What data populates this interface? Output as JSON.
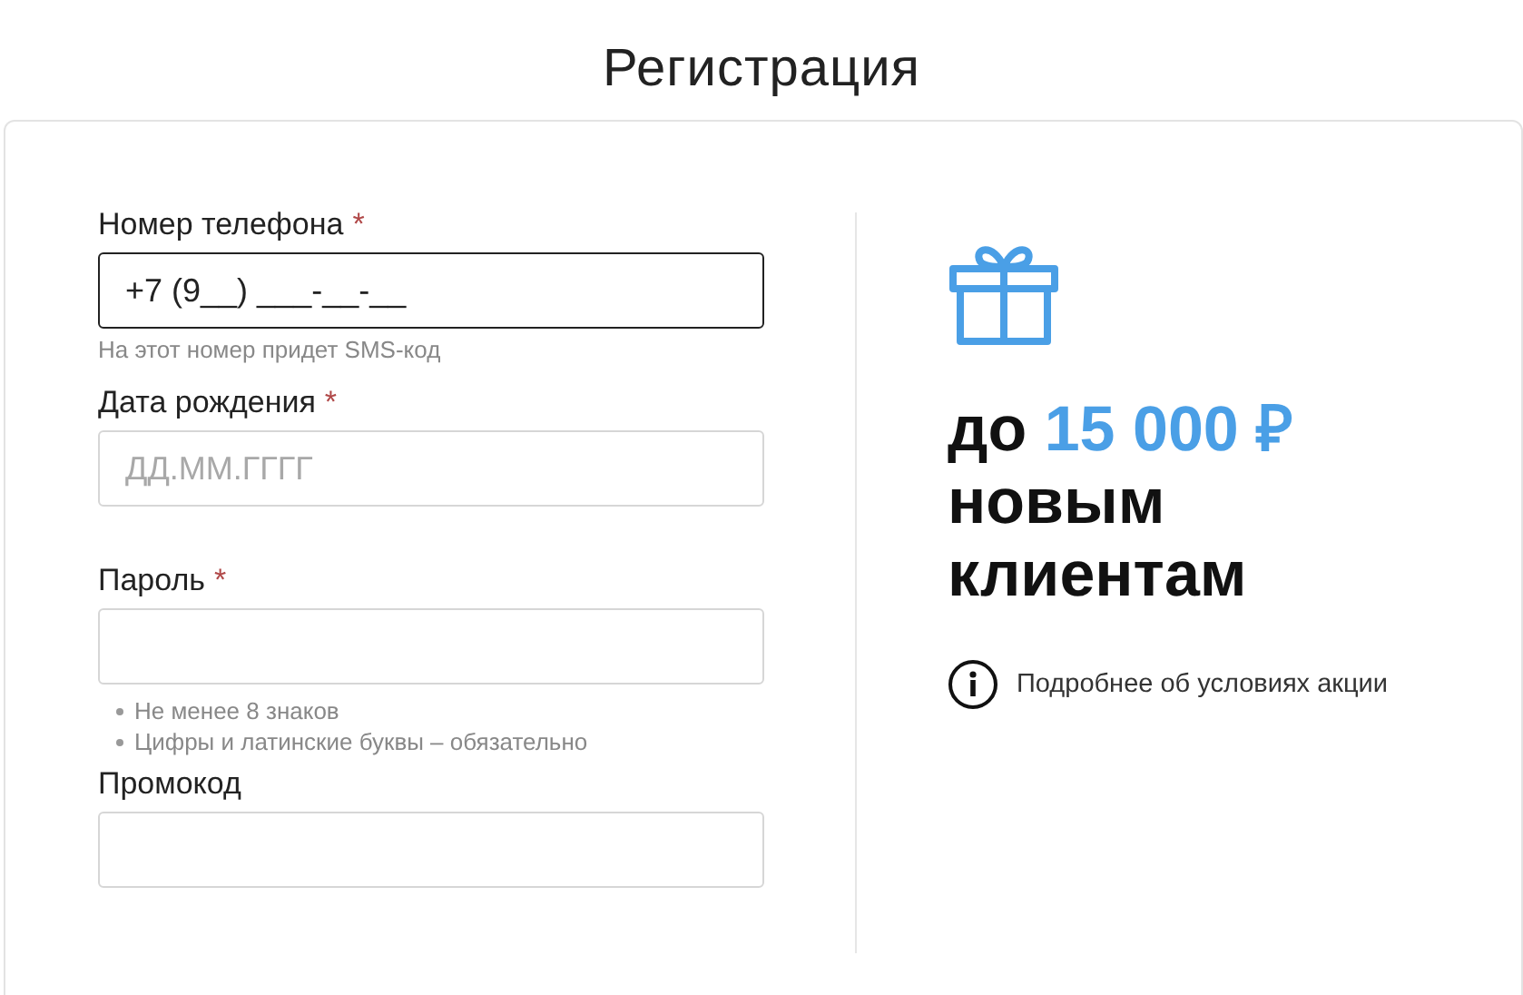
{
  "title": "Регистрация",
  "fields": [
    {
      "kind": "text",
      "label": "Номер телефона",
      "required_mark": "*",
      "value": "+7 (9__) ___-__-__",
      "focused": true,
      "hint": "На этот номер придет SMS-код"
    },
    {
      "kind": "text",
      "label": "Дата рождения",
      "required_mark": "*",
      "placeholder": "ДД.ММ.ГГГГ",
      "focused": false
    },
    {
      "kind": "password",
      "label": "Пароль",
      "required_mark": "*",
      "focused": false,
      "rules": [
        "Не менее 8 знаков",
        "Цифры и латинские буквы – обязательно"
      ]
    },
    {
      "kind": "text",
      "label": "Промокод",
      "focused": false
    }
  ],
  "promo": {
    "lead": "до",
    "amount": "15 000 ₽",
    "rest": "новым клиентам",
    "info_link": "Подробнее об условиях акции"
  }
}
